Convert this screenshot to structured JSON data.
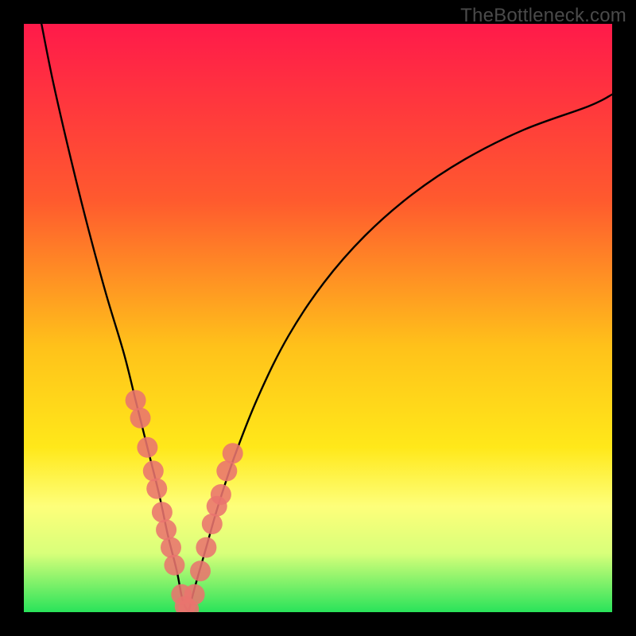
{
  "watermark": "TheBottleneck.com",
  "chart_data": {
    "type": "line",
    "title": "",
    "xlabel": "",
    "ylabel": "",
    "xlim": [
      0,
      100
    ],
    "ylim": [
      0,
      100
    ],
    "gradient_stops": [
      {
        "offset": 0,
        "color": "#ff1a4a"
      },
      {
        "offset": 30,
        "color": "#ff5a2e"
      },
      {
        "offset": 55,
        "color": "#ffc21a"
      },
      {
        "offset": 72,
        "color": "#ffe81a"
      },
      {
        "offset": 82,
        "color": "#feff7a"
      },
      {
        "offset": 90,
        "color": "#d8ff7a"
      },
      {
        "offset": 100,
        "color": "#29e35a"
      }
    ],
    "note": "x = parameter sweep, y = bottleneck percentage (0 = perfect match at bottom, 100 = severe bottleneck at top). Two curves meeting at a V-shaped minimum around x≈27.",
    "series": [
      {
        "name": "left-curve",
        "x": [
          3,
          5,
          8,
          11,
          14,
          17,
          19,
          21,
          23,
          24.5,
          26,
          27,
          28
        ],
        "values": [
          100,
          90,
          77,
          65,
          54,
          44,
          36,
          28,
          20,
          13,
          7,
          2,
          0
        ]
      },
      {
        "name": "right-curve",
        "x": [
          28,
          29,
          31,
          33,
          36,
          40,
          45,
          51,
          58,
          66,
          75,
          85,
          96,
          100
        ],
        "values": [
          0,
          4,
          11,
          18,
          27,
          37,
          47,
          56,
          64,
          71,
          77,
          82,
          86,
          88
        ]
      }
    ],
    "markers": {
      "note": "Pink dots along both curves near the V; y values are approximate bottleneck % at those x positions.",
      "color": "#e9746e",
      "radius_px": 13,
      "points": [
        {
          "x": 19.0,
          "y": 36.0
        },
        {
          "x": 19.8,
          "y": 33.0
        },
        {
          "x": 21.0,
          "y": 28.0
        },
        {
          "x": 22.0,
          "y": 24.0
        },
        {
          "x": 22.6,
          "y": 21.0
        },
        {
          "x": 23.5,
          "y": 17.0
        },
        {
          "x": 24.2,
          "y": 14.0
        },
        {
          "x": 25.0,
          "y": 11.0
        },
        {
          "x": 25.6,
          "y": 8.0
        },
        {
          "x": 26.8,
          "y": 3.0
        },
        {
          "x": 27.4,
          "y": 1.0
        },
        {
          "x": 28.0,
          "y": 0.5
        },
        {
          "x": 29.0,
          "y": 3.0
        },
        {
          "x": 30.0,
          "y": 7.0
        },
        {
          "x": 31.0,
          "y": 11.0
        },
        {
          "x": 32.0,
          "y": 15.0
        },
        {
          "x": 32.8,
          "y": 18.0
        },
        {
          "x": 33.5,
          "y": 20.0
        },
        {
          "x": 34.5,
          "y": 24.0
        },
        {
          "x": 35.5,
          "y": 27.0
        }
      ]
    }
  }
}
